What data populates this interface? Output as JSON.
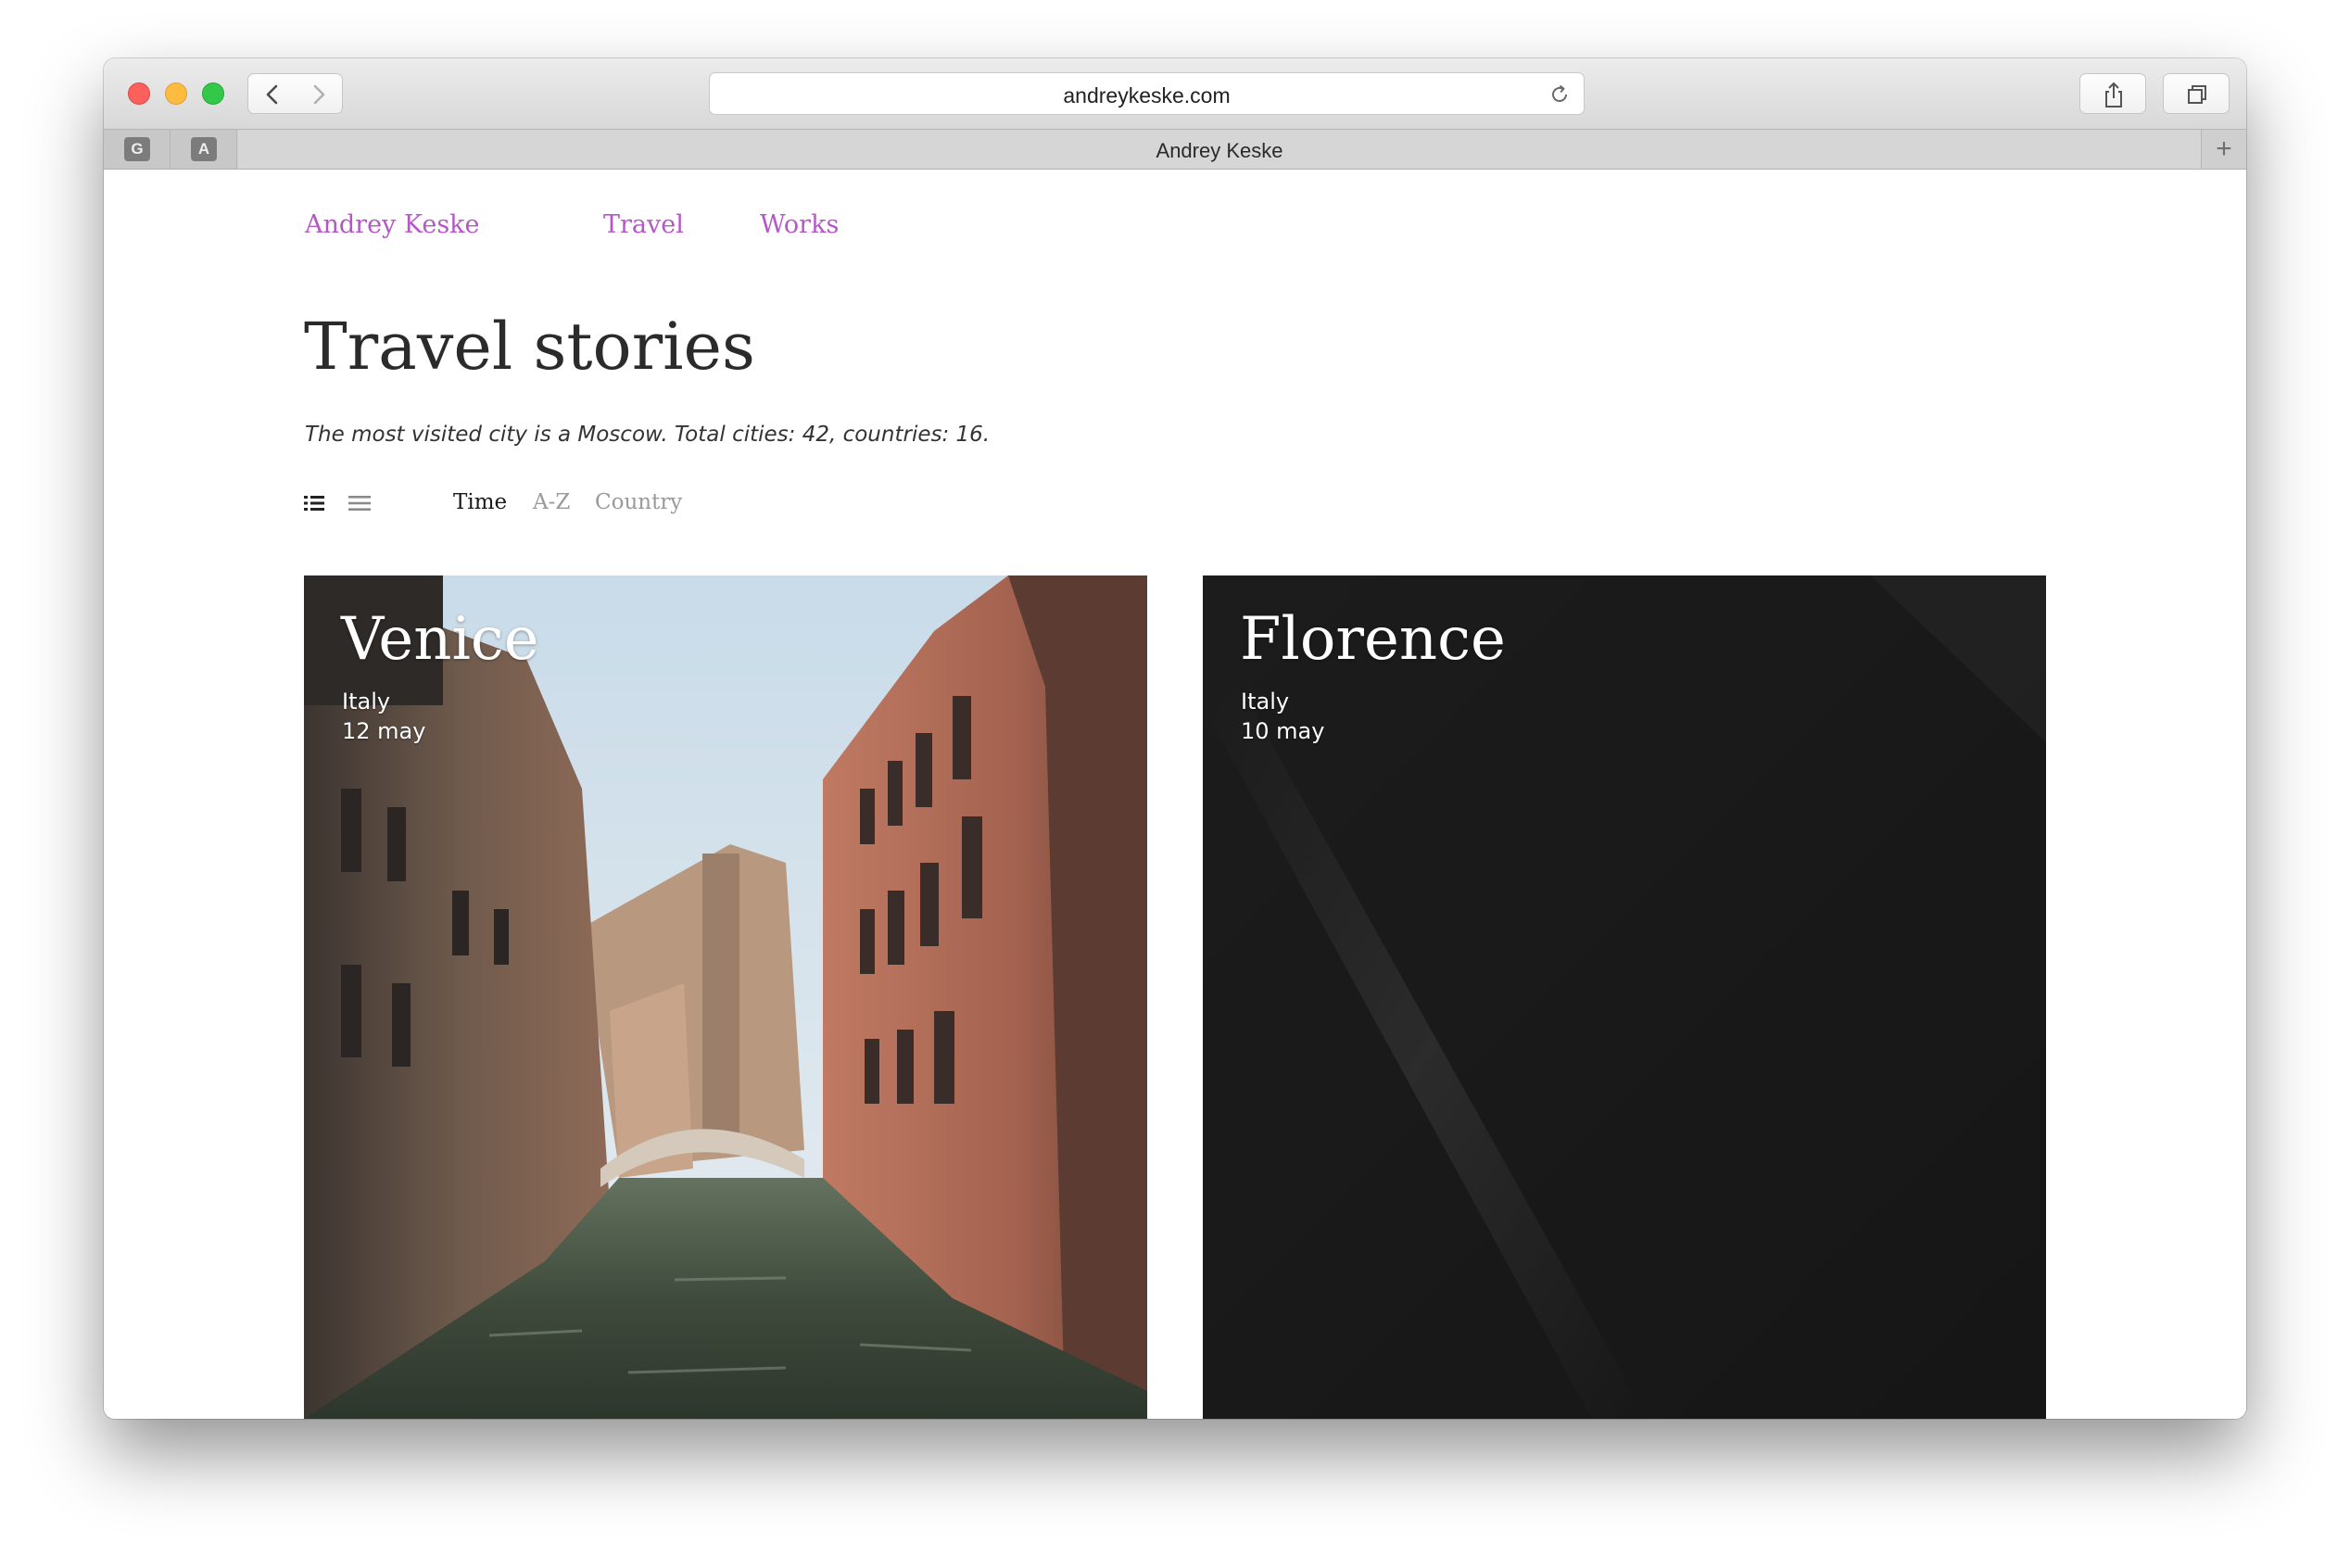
{
  "browser": {
    "url": "andreykeske.com",
    "tab_title": "Andrey Keske",
    "pinned_tabs": [
      "G",
      "A"
    ],
    "new_tab_symbol": "+"
  },
  "nav": {
    "home": "Andrey Keske",
    "travel": "Travel",
    "works": "Works",
    "link_color": "#b657c8"
  },
  "page": {
    "title": "Travel stories",
    "subtitle": "The most visited city is a Moscow. Total cities: 42, countries: 16."
  },
  "controls": {
    "view_icons": [
      "grid-view-icon",
      "list-view-icon"
    ],
    "sort_options": [
      "Time",
      "A-Z",
      "Country"
    ],
    "active_sort": "Time"
  },
  "cards": [
    {
      "city": "Venice",
      "country": "Italy",
      "date": "12 may"
    },
    {
      "city": "Florence",
      "country": "Italy",
      "date": "10 may"
    }
  ]
}
